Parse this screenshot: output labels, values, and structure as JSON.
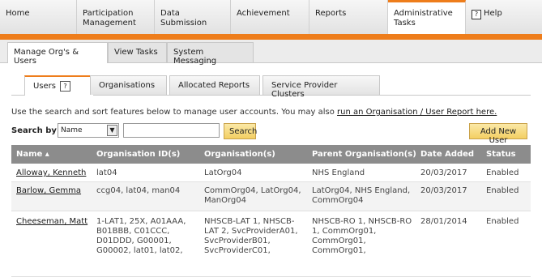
{
  "topnav": {
    "items": [
      {
        "label": "Home"
      },
      {
        "label": "Participation Management"
      },
      {
        "label": "Data Submission"
      },
      {
        "label": "Achievement"
      },
      {
        "label": "Reports"
      },
      {
        "label": "Administrative Tasks"
      },
      {
        "label": "Help"
      }
    ]
  },
  "subnav": {
    "items": [
      {
        "label": "Manage Org's & Users"
      },
      {
        "label": "View Tasks"
      },
      {
        "label": "System Messaging"
      }
    ]
  },
  "tabs": [
    {
      "label": "Users",
      "help": "?"
    },
    {
      "label": "Organisations"
    },
    {
      "label": "Allocated Reports"
    },
    {
      "label": "Service Provider Clusters"
    }
  ],
  "intro": {
    "text": "Use the search and sort features below to manage user accounts. You may also ",
    "link": "run an Organisation / User Report here."
  },
  "search": {
    "label": "Search by:",
    "selected": "Name",
    "input_value": "",
    "button": "Search",
    "add_button": "Add New User"
  },
  "table": {
    "headers": [
      "Name ▴",
      "Organisation ID(s)",
      "Organisation(s)",
      "Parent Organisation(s)",
      "Date Added",
      "Status"
    ],
    "rows": [
      {
        "name": "Alloway, Kenneth",
        "org_ids": "lat04",
        "orgs": "LatOrg04",
        "parent": "NHS England",
        "date": "20/03/2017",
        "status": "Enabled"
      },
      {
        "name": "Barlow, Gemma",
        "org_ids": "ccg04, lat04, man04",
        "orgs": "CommOrg04, LatOrg04, ManOrg04",
        "parent": "LatOrg04, NHS England, CommOrg04",
        "date": "20/03/2017",
        "status": "Enabled"
      },
      {
        "name": "Cheeseman, Matt",
        "org_ids": "1-LAT1, 25X, A01AAA, B01BBB, C01CCC, D01DDD, G00001, G00002, lat01, lat02,",
        "orgs": "NHSCB-LAT 1, NHSCB-LAT 2, SvcProviderA01, SvcProviderB01, SvcProviderC01,",
        "parent": "NHSCB-RO 1, NHSCB-RO 1, CommOrg01, CommOrg01, CommOrg01,",
        "date": "28/01/2014",
        "status": "Enabled"
      }
    ]
  }
}
